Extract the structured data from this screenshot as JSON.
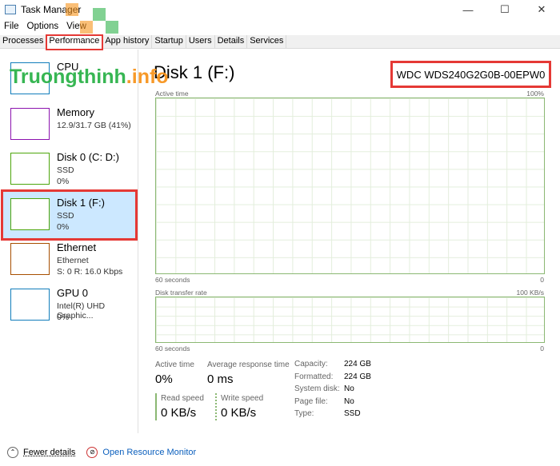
{
  "window": {
    "title": "Task Manager",
    "minimize": "—",
    "maximize": "☐",
    "close": "✕"
  },
  "menu": [
    "File",
    "Options",
    "View"
  ],
  "tabs": [
    "Processes",
    "Performance",
    "App history",
    "Startup",
    "Users",
    "Details",
    "Services"
  ],
  "active_tab": "Performance",
  "sidebar": [
    {
      "name": "CPU",
      "sub1": "",
      "sub2": "",
      "color": "#117dbb"
    },
    {
      "name": "Memory",
      "sub1": "12.9/31.7 GB (41%)",
      "sub2": "",
      "color": "#8b12ae"
    },
    {
      "name": "Disk 0 (C: D:)",
      "sub1": "SSD",
      "sub2": "0%",
      "color": "#4da60c"
    },
    {
      "name": "Disk 1 (F:)",
      "sub1": "SSD",
      "sub2": "0%",
      "color": "#4da60c",
      "selected": true
    },
    {
      "name": "Ethernet",
      "sub1": "Ethernet",
      "sub2": "S: 0 R: 16.0 Kbps",
      "color": "#a74f01"
    },
    {
      "name": "GPU 0",
      "sub1": "Intel(R) UHD Graphic...",
      "sub2": "0%",
      "color": "#117dbb"
    }
  ],
  "main": {
    "title": "Disk 1 (F:)",
    "model": "WDC WDS240G2G0B-00EPW0",
    "graph1": {
      "label": "Active time",
      "max": "100%",
      "time": "60 seconds",
      "min": "0"
    },
    "graph2": {
      "label": "Disk transfer rate",
      "max": "100 KB/s",
      "time": "60 seconds",
      "min": "0"
    },
    "active_time_label": "Active time",
    "active_time": "0%",
    "avg_resp_label": "Average response time",
    "avg_resp": "0 ms",
    "read_label": "Read speed",
    "read": "0 KB/s",
    "write_label": "Write speed",
    "write": "0 KB/s",
    "info": [
      [
        "Capacity:",
        "224 GB"
      ],
      [
        "Formatted:",
        "224 GB"
      ],
      [
        "System disk:",
        "No"
      ],
      [
        "Page file:",
        "No"
      ],
      [
        "Type:",
        "SSD"
      ]
    ]
  },
  "footer": {
    "fewer": "Fewer details",
    "monitor": "Open Resource Monitor"
  },
  "watermark": {
    "text1": "Truongthinh",
    "text2": ".info"
  }
}
